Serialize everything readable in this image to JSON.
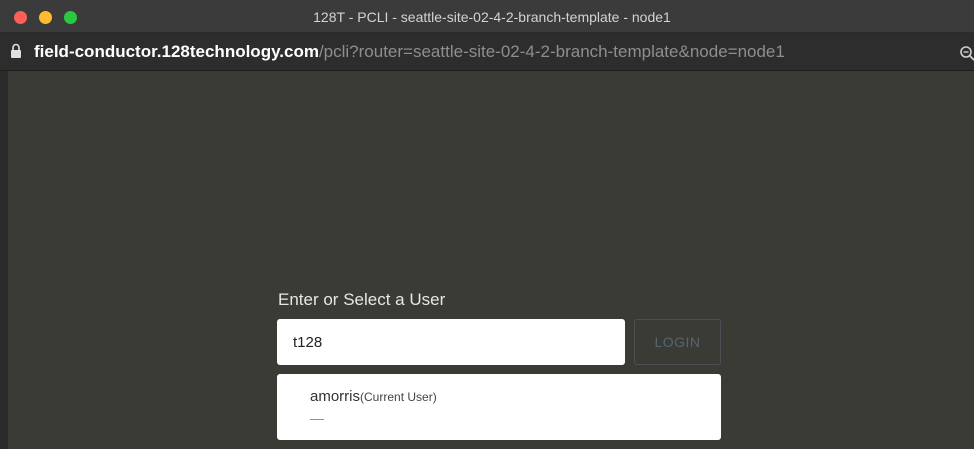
{
  "window": {
    "title": "128T - PCLI - seattle-site-02-4-2-branch-template - node1"
  },
  "urlbar": {
    "host": "field-conductor.128technology.com",
    "path": "/pcli?router=seattle-site-02-4-2-branch-template&node=node1"
  },
  "login": {
    "prompt": "Enter or Select a User",
    "input_value": "t128",
    "button_label": "LOGIN"
  },
  "users": [
    {
      "name": "amorris",
      "tag": "(Current User)",
      "detail": "—"
    }
  ],
  "colors": {
    "background": "#3a3b35",
    "traffic_red": "#fe5f57",
    "traffic_yellow": "#febc2e",
    "traffic_green": "#28c840"
  },
  "icons": {
    "lock": "lock-icon",
    "zoom": "zoom-icon"
  }
}
